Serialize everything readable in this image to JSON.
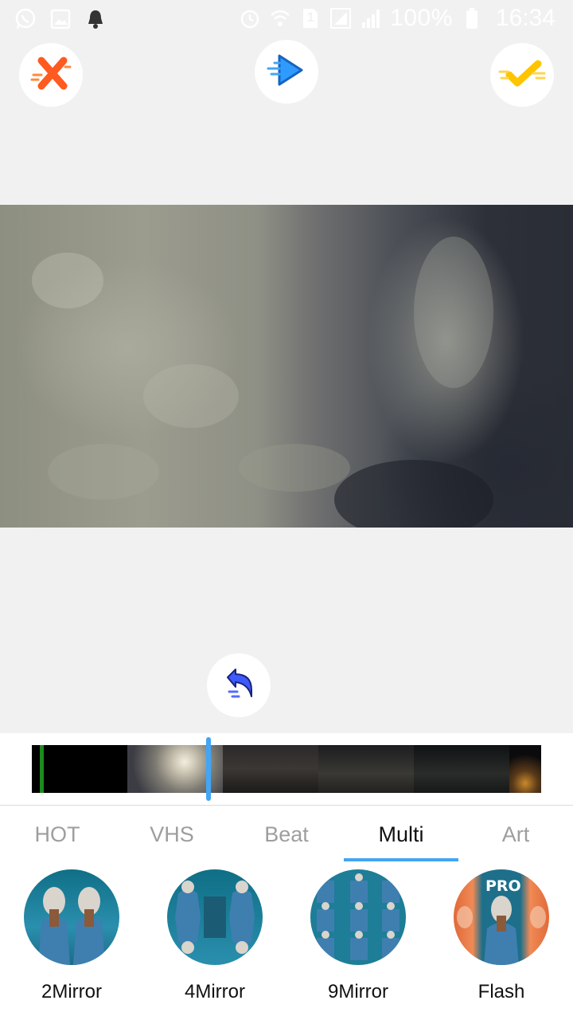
{
  "status_bar": {
    "battery": "100%",
    "time": "16:34",
    "sim_slot": "1",
    "icons_left": [
      "whatsapp-icon",
      "image-icon",
      "bell-icon"
    ],
    "icons_right": [
      "alarm-icon",
      "wifi-icon",
      "sim-icon",
      "signal-icon",
      "signal-icon",
      "battery-icon"
    ]
  },
  "toolbar": {
    "cancel_icon": "close-icon",
    "play_icon": "play-icon",
    "confirm_icon": "check-icon",
    "accent_colors": {
      "cancel": "#ff5a1f",
      "play": "#1e88e5",
      "confirm": "#ffc400"
    }
  },
  "undo": {
    "icon": "undo-icon",
    "color": "#3d5afe"
  },
  "timeline": {
    "playhead_color": "#42a5f5"
  },
  "tabs": [
    {
      "label": "HOT"
    },
    {
      "label": "VHS"
    },
    {
      "label": "Beat"
    },
    {
      "label": "Multi"
    },
    {
      "label": "Art"
    }
  ],
  "active_tab": "Multi",
  "effects": [
    {
      "label": "2Mirror"
    },
    {
      "label": "4Mirror"
    },
    {
      "label": "9Mirror"
    },
    {
      "label": "Flash",
      "badge": "PRO"
    }
  ]
}
